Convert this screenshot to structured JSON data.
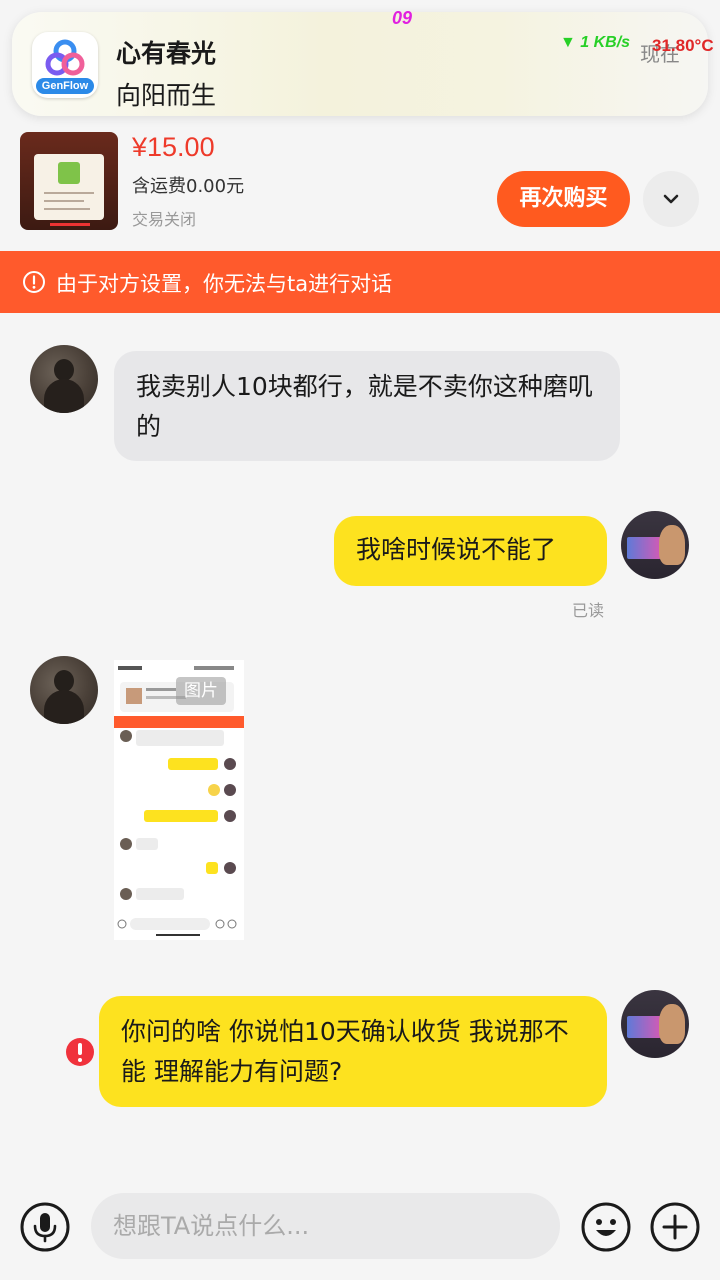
{
  "status_overlay": {
    "clock": "09",
    "net_speed": "▼ 1 KB/s",
    "temperature": "31.80°C"
  },
  "notification": {
    "app_label": "GenFlow",
    "title": "心有春光",
    "body": "向阳而生",
    "time": "现在"
  },
  "product": {
    "price": "¥15.00",
    "shipping": "含运费0.00元",
    "status": "交易关闭",
    "rebuy_label": "再次购买"
  },
  "warning": {
    "text": "由于对方设置，你无法与ta进行对话"
  },
  "messages": [
    {
      "side": "left",
      "text": "我卖别人10块都行，就是不卖你这种磨叽的"
    },
    {
      "side": "right",
      "text": "我啥时候说不能了",
      "receipt": "已读"
    },
    {
      "side": "left",
      "type": "image",
      "tag": "图片"
    },
    {
      "side": "right",
      "text": "你问的啥 你说怕10天确认收货 我说那不能 理解能力有问题?",
      "failed": true
    }
  ],
  "input": {
    "placeholder": "想跟TA说点什么..."
  },
  "colors": {
    "accent": "#ff5a1f",
    "warning_bar": "#ff5a2c",
    "my_bubble": "#fde21f",
    "their_bubble": "#e7e7e9",
    "price": "#ee3a2a",
    "error": "#f0323c"
  },
  "icons": {
    "app": "genflow-app-icon",
    "expand": "chevron-down-icon",
    "warning": "alert-circle-icon",
    "error": "error-icon",
    "mic": "mic-icon",
    "emoji": "emoji-icon",
    "plus": "plus-icon"
  }
}
